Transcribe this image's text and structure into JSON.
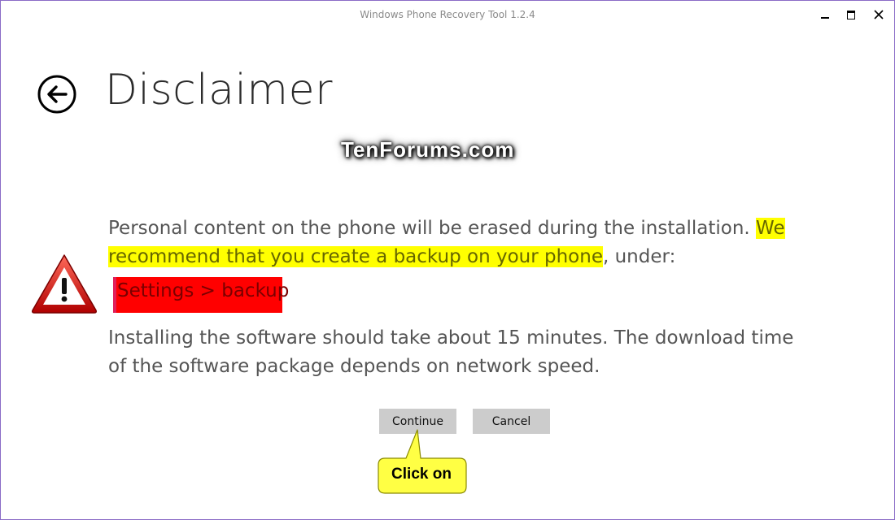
{
  "window": {
    "title": "Windows Phone Recovery Tool 1.2.4",
    "minimize_glyph": "—",
    "maximize_glyph": "☐",
    "close_glyph": "✕"
  },
  "page": {
    "title": "Disclaimer",
    "back_icon": "back-arrow-circle-icon"
  },
  "watermark": "TenForums.com",
  "content": {
    "para1_plain": "Personal content on the phone will be erased during the installation. ",
    "para1_highlight": "We recommend that you create a backup on your phone",
    "para1_tail": ", under:",
    "settings_path": "Settings > backup",
    "para2": "Installing the software should take about 15 minutes. The download time of the software package depends on network speed."
  },
  "buttons": {
    "continue_label": "Continue",
    "cancel_label": "Cancel"
  },
  "callout": {
    "text": "Click on"
  },
  "colors": {
    "highlight": "#ffff00",
    "settings_box": "#ff0000",
    "button_bg": "#cccccc",
    "callout_fill": "#ffff44",
    "warning_red": "#d01818"
  }
}
